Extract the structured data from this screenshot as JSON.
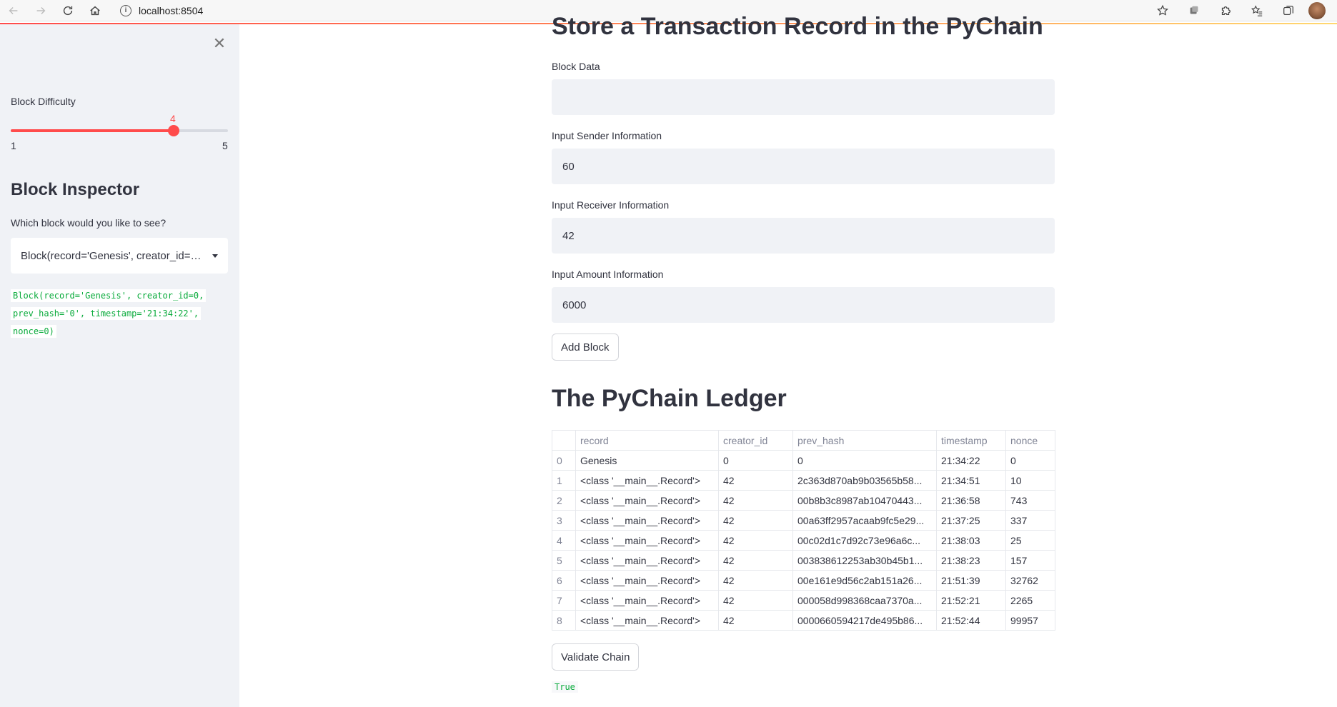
{
  "browser": {
    "url": "localhost:8504"
  },
  "sidebar": {
    "slider": {
      "label": "Block Difficulty",
      "value": "4",
      "min": "1",
      "max": "5",
      "fraction": 0.75
    },
    "inspector_title": "Block Inspector",
    "select_label": "Which block would you like to see?",
    "select_value": "Block(record='Genesis', creator_id=0, prev_hash='0', timestamp='21:34:22', nonce=0)",
    "code_lines": [
      "Block(record='Genesis', creator_id=0,",
      "prev_hash='0', timestamp='21:34:22',",
      "nonce=0)"
    ]
  },
  "main": {
    "store_title": "Store a Transaction Record in the PyChain",
    "fields": [
      {
        "label": "Block Data",
        "value": ""
      },
      {
        "label": "Input Sender Information",
        "value": "60"
      },
      {
        "label": "Input Receiver Information",
        "value": "42"
      },
      {
        "label": "Input Amount Information",
        "value": "6000"
      }
    ],
    "add_block_label": "Add Block",
    "ledger_title": "The PyChain Ledger",
    "table": {
      "columns": [
        "",
        "record",
        "creator_id",
        "prev_hash",
        "timestamp",
        "nonce"
      ],
      "rows": [
        [
          "0",
          "Genesis",
          "0",
          "0",
          "21:34:22",
          "0"
        ],
        [
          "1",
          "<class '__main__.Record'>",
          "42",
          "2c363d870ab9b03565b58...",
          "21:34:51",
          "10"
        ],
        [
          "2",
          "<class '__main__.Record'>",
          "42",
          "00b8b3c8987ab10470443...",
          "21:36:58",
          "743"
        ],
        [
          "3",
          "<class '__main__.Record'>",
          "42",
          "00a63ff2957acaab9fc5e29...",
          "21:37:25",
          "337"
        ],
        [
          "4",
          "<class '__main__.Record'>",
          "42",
          "00c02d1c7d92c73e96a6c...",
          "21:38:03",
          "25"
        ],
        [
          "5",
          "<class '__main__.Record'>",
          "42",
          "003838612253ab30b45b1...",
          "21:38:23",
          "157"
        ],
        [
          "6",
          "<class '__main__.Record'>",
          "42",
          "00e161e9d56c2ab151a26...",
          "21:51:39",
          "32762"
        ],
        [
          "7",
          "<class '__main__.Record'>",
          "42",
          "000058d998368caa7370a...",
          "21:52:21",
          "2265"
        ],
        [
          "8",
          "<class '__main__.Record'>",
          "42",
          "0000660594217de495b86...",
          "21:52:44",
          "99957"
        ]
      ]
    },
    "validate_label": "Validate Chain",
    "validate_result": "True"
  }
}
